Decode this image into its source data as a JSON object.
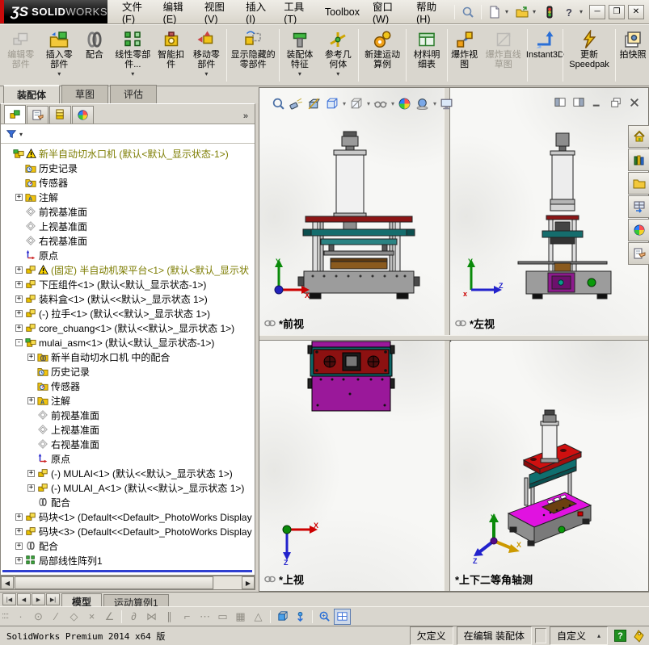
{
  "window": {
    "logo_z": "ƷS",
    "logo_bold": "SOLID",
    "logo_light": "WORKS"
  },
  "menu_bar": {
    "items": [
      {
        "id": "file",
        "label": "文件(F)"
      },
      {
        "id": "edit",
        "label": "编辑(E)"
      },
      {
        "id": "view",
        "label": "视图(V)"
      },
      {
        "id": "insert",
        "label": "插入(I)"
      },
      {
        "id": "tools",
        "label": "工具(T)"
      },
      {
        "id": "toolbox",
        "label": "Toolbox"
      },
      {
        "id": "window",
        "label": "窗口(W)"
      },
      {
        "id": "help",
        "label": "帮助(H)"
      }
    ]
  },
  "title_icons": [
    {
      "id": "search",
      "icon": "search"
    },
    {
      "id": "sep",
      "sep": true
    },
    {
      "id": "new-document",
      "icon": "newdoc",
      "arrow": true
    },
    {
      "id": "open-document",
      "icon": "open",
      "arrow": true
    },
    {
      "id": "toolbox-status",
      "icon": "traffic"
    },
    {
      "id": "help",
      "icon": "qmark",
      "arrow": true
    }
  ],
  "window_buttons": [
    {
      "id": "minimize",
      "glyph": "─"
    },
    {
      "id": "restore",
      "glyph": "❐"
    },
    {
      "id": "close",
      "glyph": "✕"
    }
  ],
  "toolbar": {
    "buttons": [
      {
        "id": "edit-component",
        "label": "编辑零部件",
        "icon": "editcomp",
        "disabled": true
      },
      {
        "id": "insert-component",
        "label": "插入零部件",
        "icon": "insertcomp",
        "arrow": true
      },
      {
        "id": "mate",
        "label": "配合",
        "icon": "mateclip"
      },
      {
        "id": "linear-component-pattern",
        "label": "线性零部件...",
        "icon": "linpattern",
        "arrow": true
      },
      {
        "id": "smart-fasteners",
        "label": "智能扣件",
        "icon": "smartfast"
      },
      {
        "id": "move-component",
        "label": "移动零部件",
        "icon": "movecomp",
        "arrow": true
      },
      {
        "sep": true
      },
      {
        "id": "show-hidden-components",
        "label": "显示隐藏的零部件",
        "icon": "showhidden"
      },
      {
        "sep": true
      },
      {
        "id": "assembly-features",
        "label": "装配体特征",
        "icon": "asmfeat",
        "arrow": true
      },
      {
        "id": "reference-geometry",
        "label": "参考几何体",
        "icon": "refgeom",
        "arrow": true
      },
      {
        "sep": true
      },
      {
        "id": "new-motion-study",
        "label": "新建运动算例",
        "icon": "motion"
      },
      {
        "sep": true
      },
      {
        "id": "bill-of-materials",
        "label": "材料明细表",
        "icon": "bom"
      },
      {
        "sep": true
      },
      {
        "id": "exploded-view",
        "label": "爆炸视图",
        "icon": "explode"
      },
      {
        "id": "explode-line-sketch",
        "label": "爆炸直线草图",
        "icon": "explsketch",
        "disabled": true
      },
      {
        "sep": true
      },
      {
        "id": "instant3d",
        "label": "Instant3D",
        "icon": "instant3d"
      },
      {
        "sep": true
      },
      {
        "id": "update-speedpak",
        "label": "更新 Speedpak",
        "icon": "speedpak"
      },
      {
        "sep": true
      },
      {
        "id": "take-snapshot",
        "label": "拍快照",
        "icon": "snapshot"
      }
    ]
  },
  "command_tabs": [
    {
      "id": "assembly",
      "label": "装配体",
      "active": true
    },
    {
      "id": "sketch",
      "label": "草图",
      "active": false
    },
    {
      "id": "evaluate",
      "label": "评估",
      "active": false
    }
  ],
  "feature_manager": {
    "tabs": [
      "feature-tree",
      "property-manager",
      "configuration-manager",
      "display-manager"
    ],
    "overflow": "»",
    "tree": [
      {
        "d": 0,
        "i": "asm",
        "w": true,
        "o": true,
        "t": "新半自动切水口机  (默认<默认_显示状态-1>)"
      },
      {
        "d": 1,
        "i": "history",
        "t": "历史记录"
      },
      {
        "d": 1,
        "i": "sensor",
        "t": "传感器"
      },
      {
        "d": 1,
        "i": "ann",
        "e": "+",
        "t": "注解"
      },
      {
        "d": 1,
        "i": "plane",
        "t": "前视基准面"
      },
      {
        "d": 1,
        "i": "plane",
        "t": "上视基准面"
      },
      {
        "d": 1,
        "i": "plane",
        "t": "右视基准面"
      },
      {
        "d": 1,
        "i": "origin",
        "t": "原点"
      },
      {
        "d": 1,
        "i": "comp",
        "e": "+",
        "w": true,
        "o": true,
        "t": "(固定) 半自动机架平台<1> (默认<默认_显示状"
      },
      {
        "d": 1,
        "i": "comp",
        "e": "+",
        "t": "下压组件<1> (默认<默认_显示状态-1>)"
      },
      {
        "d": 1,
        "i": "comp",
        "e": "+",
        "t": "装料盒<1> (默认<<默认>_显示状态 1>)"
      },
      {
        "d": 1,
        "i": "comp",
        "e": "+",
        "t": "(-) 拉手<1> (默认<<默认>_显示状态 1>)"
      },
      {
        "d": 1,
        "i": "comp",
        "e": "+",
        "t": "core_chuang<1> (默认<<默认>_显示状态 1>)"
      },
      {
        "d": 1,
        "i": "asm",
        "e": "-",
        "t": "mulai_asm<1> (默认<默认_显示状态-1>)"
      },
      {
        "d": 2,
        "i": "matein",
        "e": "+",
        "t": "新半自动切水口机 中的配合"
      },
      {
        "d": 2,
        "i": "history",
        "t": "历史记录"
      },
      {
        "d": 2,
        "i": "sensor",
        "t": "传感器"
      },
      {
        "d": 2,
        "i": "ann",
        "e": "+",
        "t": "注解"
      },
      {
        "d": 2,
        "i": "plane",
        "t": "前视基准面"
      },
      {
        "d": 2,
        "i": "plane",
        "t": "上视基准面"
      },
      {
        "d": 2,
        "i": "plane",
        "t": "右视基准面"
      },
      {
        "d": 2,
        "i": "origin",
        "t": "原点"
      },
      {
        "d": 2,
        "i": "comp",
        "e": "+",
        "t": "(-) MULAI<1> (默认<<默认>_显示状态 1>)"
      },
      {
        "d": 2,
        "i": "comp",
        "e": "+",
        "t": "(-) MULAI_A<1> (默认<<默认>_显示状态 1>)"
      },
      {
        "d": 2,
        "i": "mate",
        "t": "配合"
      },
      {
        "d": 1,
        "i": "comp",
        "e": "+",
        "t": "码块<1> (Default<<Default>_PhotoWorks Display"
      },
      {
        "d": 1,
        "i": "comp",
        "e": "+",
        "t": "码块<3> (Default<<Default>_PhotoWorks Display"
      },
      {
        "d": 1,
        "i": "mate",
        "e": "+",
        "t": "配合"
      },
      {
        "d": 1,
        "i": "pattern",
        "e": "+",
        "t": "局部线性阵列1"
      }
    ]
  },
  "headsup_toolbar": [
    {
      "id": "zoom-to-fit",
      "icon": "hzoom"
    },
    {
      "id": "zoom-to-area",
      "icon": "hflash"
    },
    {
      "id": "section-view",
      "icon": "hsection"
    },
    {
      "id": "view-orientation",
      "icon": "hcube",
      "arrow": true
    },
    {
      "id": "display-style",
      "icon": "hstyle",
      "arrow": true
    },
    {
      "id": "hide-show-items",
      "icon": "hglasses",
      "arrow": true
    },
    {
      "id": "edit-appearance",
      "icon": "hsphere"
    },
    {
      "id": "apply-scene",
      "icon": "hscene",
      "arrow": true
    },
    {
      "id": "view-settings",
      "icon": "hmonitor"
    }
  ],
  "doc_window_buttons": [
    {
      "id": "tile-left",
      "icon": "dtileL"
    },
    {
      "id": "tile-right",
      "icon": "dtileR"
    },
    {
      "id": "doc-minimize",
      "icon": "dmin"
    },
    {
      "id": "doc-restore",
      "icon": "drestore"
    },
    {
      "id": "doc-close",
      "icon": "dclose"
    }
  ],
  "viewports": [
    {
      "id": "front",
      "label": "*前视",
      "linked": true
    },
    {
      "id": "left",
      "label": "*左视",
      "linked": true
    },
    {
      "id": "top",
      "label": "*上视",
      "linked": true
    },
    {
      "id": "isometric",
      "label": "*上下二等角轴测",
      "linked": false
    }
  ],
  "task_pane": [
    {
      "id": "solidworks-resources",
      "icon": "tphome"
    },
    {
      "id": "design-library",
      "icon": "tplib"
    },
    {
      "id": "file-explorer",
      "icon": "tpfolder"
    },
    {
      "id": "view-palette",
      "icon": "tppalette"
    },
    {
      "id": "appearances-scenes",
      "icon": "tpsphere"
    },
    {
      "id": "custom-properties",
      "icon": "tpprops"
    }
  ],
  "bottom_bar": {
    "nav": [
      {
        "id": "first",
        "glyph": "|◀"
      },
      {
        "id": "prev",
        "glyph": "◀"
      },
      {
        "id": "next",
        "glyph": "▶"
      },
      {
        "id": "last",
        "glyph": "▶|"
      }
    ],
    "tabs": [
      {
        "id": "model",
        "label": "模型",
        "active": true
      },
      {
        "id": "motion-study-1",
        "label": "运动算例1",
        "active": false
      }
    ]
  },
  "sketch_toolbar": [
    {
      "id": "point",
      "glyph": "·"
    },
    {
      "id": "circle",
      "glyph": "⊙"
    },
    {
      "id": "line",
      "glyph": "∕"
    },
    {
      "id": "polygon",
      "glyph": "◇"
    },
    {
      "id": "trim",
      "glyph": "×"
    },
    {
      "id": "sketch-fillet",
      "glyph": "∠"
    },
    {
      "sep": true
    },
    {
      "id": "tangent-arc",
      "glyph": "∂"
    },
    {
      "id": "mirror-entities",
      "glyph": "⋈"
    },
    {
      "id": "offset-entities",
      "glyph": "∥"
    },
    {
      "id": "corner-rectangle",
      "glyph": "⌐"
    },
    {
      "id": "construction-line",
      "glyph": "⋯"
    },
    {
      "id": "slot",
      "glyph": "▭"
    },
    {
      "id": "grid",
      "glyph": "▦"
    },
    {
      "id": "angle",
      "glyph": "△"
    },
    {
      "sep": true
    },
    {
      "id": "instant3d-cube",
      "icon": "skcube"
    },
    {
      "id": "move-entity",
      "icon": "skmove"
    },
    {
      "sep": true
    },
    {
      "id": "zoom-tool",
      "icon": "skzoom"
    },
    {
      "id": "viewport-layout",
      "icon": "skview",
      "pressed": true
    }
  ],
  "status_bar": {
    "product": "SolidWorks Premium 2014 x64 版",
    "define_state": "欠定义",
    "edit_state": "在编辑 装配体",
    "custom": "自定义"
  }
}
